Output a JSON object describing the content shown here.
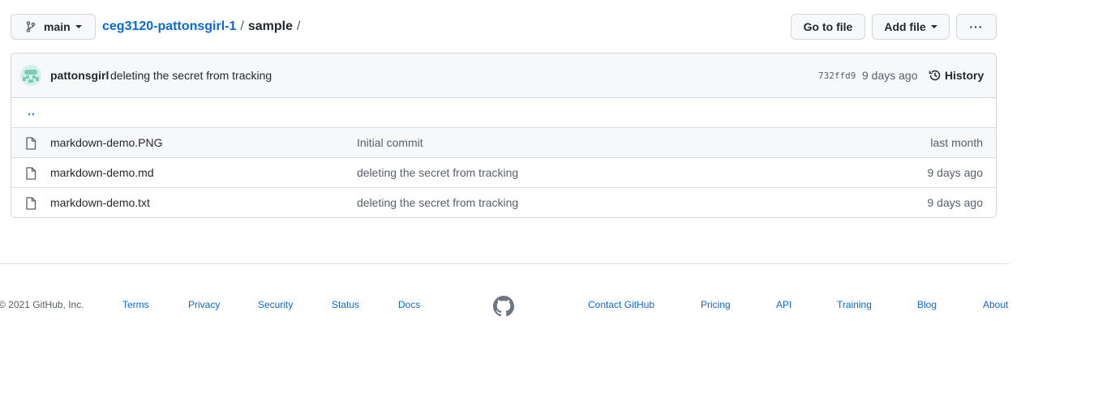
{
  "toolbar": {
    "branch": "main",
    "breadcrumb": {
      "repo": "ceg3120-pattonsgirl-1",
      "separator": "/",
      "dir": "sample",
      "trailing": "/"
    },
    "goto_file": "Go to file",
    "add_file": "Add file",
    "more": "···"
  },
  "latest_commit": {
    "author": "pattonsgirl",
    "message": "deleting the secret from tracking",
    "sha": "732ffd9",
    "time": "9 days ago",
    "history_label": "History"
  },
  "parent_dir": "..",
  "files": [
    {
      "name": "markdown-demo.PNG",
      "commit": "Initial commit",
      "age": "last month"
    },
    {
      "name": "markdown-demo.md",
      "commit": "deleting the secret from tracking",
      "age": "9 days ago"
    },
    {
      "name": "markdown-demo.txt",
      "commit": "deleting the secret from tracking",
      "age": "9 days ago"
    }
  ],
  "footer": {
    "copyright": "© 2021 GitHub, Inc.",
    "left_links": [
      "Terms",
      "Privacy",
      "Security",
      "Status",
      "Docs"
    ],
    "right_links": [
      "Contact GitHub",
      "Pricing",
      "API",
      "Training",
      "Blog",
      "About"
    ]
  },
  "colors": {
    "link": "#0969da",
    "muted": "#57606a",
    "border": "#d0d7de",
    "header_bg": "#f6f8fa"
  }
}
